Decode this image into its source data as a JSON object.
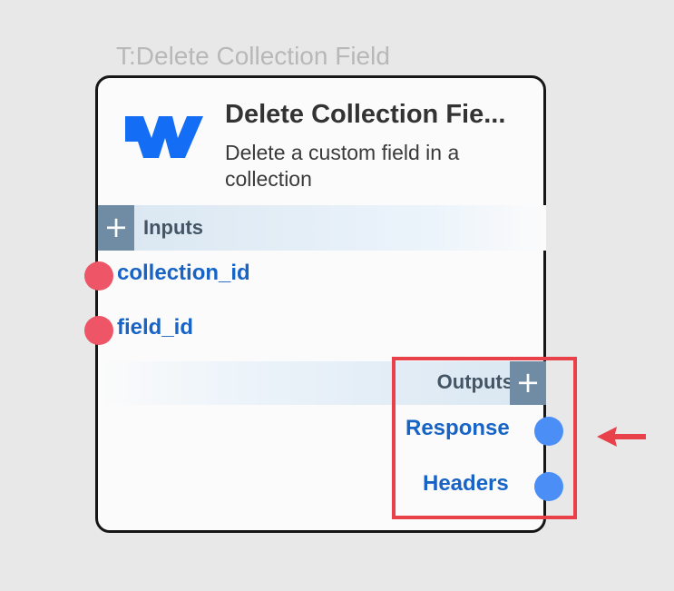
{
  "node": {
    "type_label": "T:Delete Collection Field",
    "title": "Delete Collection Fie...",
    "description": "Delete a custom field in a collection",
    "logo_icon": "webflow-logo",
    "inputs_section": {
      "label": "Inputs",
      "add_icon": "+"
    },
    "inputs": [
      {
        "label": "collection_id"
      },
      {
        "label": "field_id"
      }
    ],
    "outputs_section": {
      "label": "Outputs",
      "add_icon": "+"
    },
    "outputs": [
      {
        "label": "Response"
      },
      {
        "label": "Headers"
      }
    ]
  },
  "annotation": {
    "highlight_color": "#e8414a",
    "arrow_icon": "left-arrow-icon"
  },
  "colors": {
    "background": "#e8e8e8",
    "card_border": "#161616",
    "input_port": "#ee5566",
    "output_port": "#4a8ef6",
    "port_label": "#1763c6",
    "section_button": "#6f8ca4",
    "logo": "#146ef5"
  }
}
